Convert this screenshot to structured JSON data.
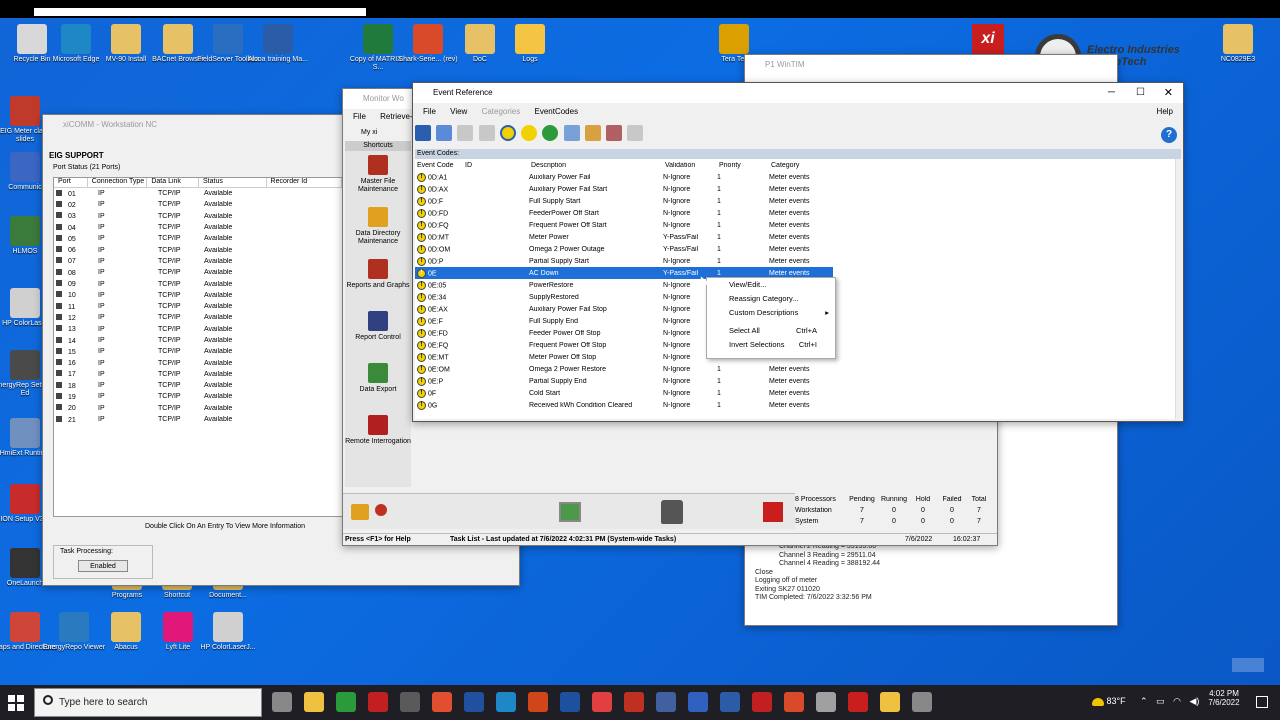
{
  "desktop_icons": [
    {
      "label": "Recycle Bin",
      "color": "#d8d8d8"
    },
    {
      "label": "Microsoft Edge",
      "color": "#1e88c7"
    },
    {
      "label": "MV-90 Install",
      "color": "#e6c165"
    },
    {
      "label": "BACnet Browser",
      "color": "#e6c165"
    },
    {
      "label": "FieldServer Toolbox",
      "color": "#2a6ebf"
    },
    {
      "label": "Alcoa training Ma...",
      "color": "#2b5ca8"
    },
    {
      "label": "Copy of MATRIX - S...",
      "color": "#1f7a3c"
    },
    {
      "label": "Shark-Serie... (rev)",
      "color": "#d84a2a"
    },
    {
      "label": "DoC",
      "color": "#e6c165"
    },
    {
      "label": "Logs",
      "color": "#f4c542"
    },
    {
      "label": "Tera Ter",
      "color": "#d9a000"
    },
    {
      "label": "NC0829E3",
      "color": "#e6c165"
    },
    {
      "label": "EIG Meter class slides",
      "color": "#c03a2b"
    },
    {
      "label": "Communic",
      "color": "#3b66c4"
    },
    {
      "label": "HLMOS",
      "color": "#3a7a3a"
    },
    {
      "label": "HP ColorLaser",
      "color": "#d0d0d0"
    },
    {
      "label": "EnergyRep Settings Ed",
      "color": "#4a4a4a"
    },
    {
      "label": "HmiExt Runtime",
      "color": "#7090c0"
    },
    {
      "label": "ION Setup V3.0",
      "color": "#c82b2b"
    },
    {
      "label": "OneLaunch",
      "color": "#333333"
    },
    {
      "label": "Maps and Directions",
      "color": "#d0453a"
    },
    {
      "label": "EnergyRepo Viewer",
      "color": "#2a7ac0"
    },
    {
      "label": "Abacus",
      "color": "#e6c165"
    },
    {
      "label": "Lyft Lite",
      "color": "#e2177a"
    },
    {
      "label": "HP ColorLaserJ...",
      "color": "#d0d0d0"
    },
    {
      "label": "Programs",
      "color": "#e6c165"
    },
    {
      "label": "Shortcut",
      "color": "#e6c165"
    },
    {
      "label": "Document...",
      "color": "#e6c165"
    }
  ],
  "brand": {
    "logo_text": "Electro Industries GaugeTech",
    "xi_text": "xi"
  },
  "xicomm": {
    "title": "xiCOMM - Workstation NC",
    "heading": "EIG SUPPORT",
    "group_label": "Port Status (21 Ports)",
    "columns": [
      "Port",
      "Connection Type",
      "Data Link",
      "Status",
      "Recorder Id"
    ],
    "ports": [
      "01",
      "02",
      "03",
      "04",
      "05",
      "06",
      "07",
      "08",
      "09",
      "10",
      "11",
      "12",
      "13",
      "14",
      "15",
      "16",
      "17",
      "18",
      "19",
      "20",
      "21"
    ],
    "conn_type": "IP",
    "data_link": "TCP/IP",
    "status": "Available",
    "hint": "Double Click On An Entry To View More Information",
    "task_processing_label": "Task Processing:",
    "enabled_button": "Enabled"
  },
  "monitor": {
    "title": "Monitor",
    "title_suffix": "Wo",
    "menu": [
      "File",
      "Retrieve-Co"
    ],
    "profile": "My xi",
    "shortcuts_label": "Shortcuts",
    "shortcuts": [
      {
        "label": "Master File Maintenance",
        "color": "#b03020"
      },
      {
        "label": "Data Directory Maintenance",
        "color": "#e0a020"
      },
      {
        "label": "Reports and Graphs",
        "color": "#b03020"
      },
      {
        "label": "Report Control",
        "color": "#304080"
      },
      {
        "label": "Data Export",
        "color": "#3a8a3a"
      },
      {
        "label": "Remote Interrogation",
        "color": "#b02020"
      }
    ],
    "status_help": "Press <F1> for Help",
    "task_list": "Task List - Last updated at 7/6/2022 4:02:31 PM (System-wide Tasks)",
    "date": "7/6/2022",
    "time": "16:02:37",
    "processors": {
      "headers": [
        "8 Processors",
        "Pending",
        "Running",
        "Hold",
        "Failed",
        "Total"
      ],
      "rows": [
        [
          "Workstation",
          "7",
          "0",
          "0",
          "0",
          "7"
        ],
        [
          "System",
          "7",
          "0",
          "0",
          "0",
          "7"
        ]
      ]
    }
  },
  "wintim": {
    "title": "P1 WinTIM",
    "lines": [
      "Channel 2 Reading = 39193.00",
      "Channel 3 Reading = 29511.04",
      "Channel 4 Reading = 388192.44",
      "Close",
      "Logging off of meter",
      "Exiting SK27 011020",
      "TIM Completed: 7/6/2022 3:32:56 PM"
    ]
  },
  "event_ref": {
    "title": "Event Reference",
    "menu": [
      "File",
      "View",
      "Categories",
      "EventCodes"
    ],
    "help": "Help",
    "panel_label": "Event Codes:",
    "columns": [
      "Event Code",
      "ID",
      "Description",
      "Validation",
      "Priority",
      "Category"
    ],
    "rows": [
      {
        "code": "0D:A1",
        "desc": "Auxiliary Power Fail",
        "val": "N-Ignore",
        "pri": "1",
        "cat": "Meter events"
      },
      {
        "code": "0D:AX",
        "desc": "Auxiliary Power Fail Start",
        "val": "N-Ignore",
        "pri": "1",
        "cat": "Meter events"
      },
      {
        "code": "0D:F",
        "desc": "Full Supply Start",
        "val": "N-Ignore",
        "pri": "1",
        "cat": "Meter events"
      },
      {
        "code": "0D:FD",
        "desc": "FeederPower Off Start",
        "val": "N-Ignore",
        "pri": "1",
        "cat": "Meter events"
      },
      {
        "code": "0D:FQ",
        "desc": "Frequent Power Off Start",
        "val": "N-Ignore",
        "pri": "1",
        "cat": "Meter events"
      },
      {
        "code": "0D:MT",
        "desc": "Meter Power",
        "val": "Y-Pass/Fail",
        "pri": "1",
        "cat": "Meter events"
      },
      {
        "code": "0D:OM",
        "desc": "Omega 2 Power Outage",
        "val": "Y-Pass/Fail",
        "pri": "1",
        "cat": "Meter events"
      },
      {
        "code": "0D:P",
        "desc": "Partial Supply Start",
        "val": "N-Ignore",
        "pri": "1",
        "cat": "Meter events"
      },
      {
        "code": "0E",
        "desc": "AC Down",
        "val": "Y-Pass/Fail",
        "pri": "1",
        "cat": "Meter events"
      },
      {
        "code": "0E:05",
        "desc": "PowerRestore",
        "val": "N-Ignore",
        "pri": "1",
        "cat": "Meter events"
      },
      {
        "code": "0E:34",
        "desc": "SupplyRestored",
        "val": "N-Ignore",
        "pri": "1",
        "cat": "Meter events"
      },
      {
        "code": "0E:AX",
        "desc": "Auxiliary Power Fail Stop",
        "val": "N-Ignore",
        "pri": "1",
        "cat": "Meter events"
      },
      {
        "code": "0E:F",
        "desc": "Full Supply End",
        "val": "N-Ignore",
        "pri": "1",
        "cat": "Meter events"
      },
      {
        "code": "0E:FD",
        "desc": "Feeder Power Off Stop",
        "val": "N-Ignore",
        "pri": "1",
        "cat": "Meter events"
      },
      {
        "code": "0E:FQ",
        "desc": "Frequent Power Off Stop",
        "val": "N-Ignore",
        "pri": "1",
        "cat": "Meter events"
      },
      {
        "code": "0E:MT",
        "desc": "Meter Power Off Stop",
        "val": "N-Ignore",
        "pri": "1",
        "cat": "Meter events"
      },
      {
        "code": "0E:OM",
        "desc": "Omega 2 Power Restore",
        "val": "N-Ignore",
        "pri": "1",
        "cat": "Meter events"
      },
      {
        "code": "0E:P",
        "desc": "Partial Supply End",
        "val": "N-Ignore",
        "pri": "1",
        "cat": "Meter events"
      },
      {
        "code": "0F",
        "desc": "Cold Start",
        "val": "N-Ignore",
        "pri": "1",
        "cat": "Meter events"
      },
      {
        "code": "0G",
        "desc": "Received kWh Condition Cleared",
        "val": "N-Ignore",
        "pri": "1",
        "cat": "Meter events"
      }
    ],
    "selected_index": 8
  },
  "context_menu": {
    "items": [
      {
        "label": "View/Edit...",
        "shortcut": ""
      },
      {
        "label": "Reassign Category...",
        "shortcut": ""
      },
      {
        "label": "Custom Descriptions",
        "shortcut": "▸"
      },
      {
        "label": "Select All",
        "shortcut": "Ctrl+A"
      },
      {
        "label": "Invert Selections",
        "shortcut": "Ctrl+I"
      }
    ]
  },
  "taskbar": {
    "search_placeholder": "Type here to search",
    "weather": "83°F",
    "time": "4:02 PM",
    "date": "7/6/2022"
  }
}
